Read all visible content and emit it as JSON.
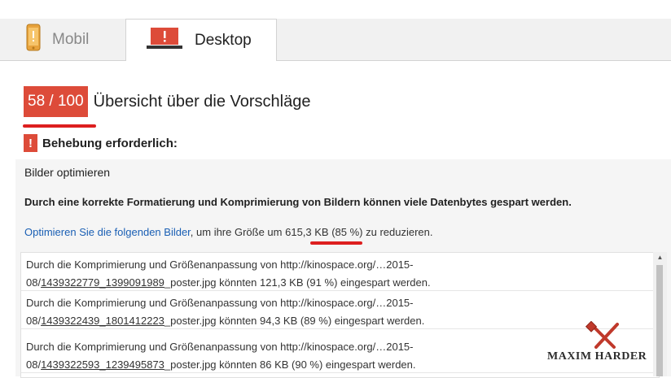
{
  "tabs": {
    "mobile": {
      "label": "Mobil",
      "icon": "phone-icon"
    },
    "desktop": {
      "label": "Desktop",
      "icon": "laptop-icon"
    }
  },
  "score": {
    "value": "58 / 100",
    "title": "Übersicht über die Vorschläge"
  },
  "fix": {
    "label": "Behebung erforderlich:"
  },
  "rule": {
    "title": "Bilder optimieren",
    "description": "Durch eine korrekte Formatierung und Komprimierung von Bildern können viele Datenbytes gespart werden.",
    "optimize_link": "Optimieren Sie die folgenden Bilder",
    "optimize_mid": ", um ihre Größe um ",
    "optimize_size": "615,3 KB",
    "optimize_rest": " (85 %) zu reduzieren."
  },
  "items": [
    {
      "prefix": "Durch die Komprimierung und Größenanpassung von http://kinospace.org/…2015-",
      "path_start": "08/",
      "file": "1439322779_1399091989",
      "suffix": "_poster.jpg könnten 121,3 KB (91 %) eingespart werden."
    },
    {
      "prefix": "Durch die Komprimierung und Größenanpassung von http://kinospace.org/…2015-",
      "path_start": "08/",
      "file": "1439322439_1801412223",
      "suffix": "_poster.jpg könnten 94,3 KB (89 %) eingespart werden."
    },
    {
      "prefix": "Durch die Komprimierung und Größenanpassung von http://kinospace.org/…2015-",
      "path_start": "08/",
      "file": "1439322593_1239495873",
      "suffix": "_poster.jpg könnten 86 KB (90 %) eingespart werden."
    }
  ],
  "watermark": {
    "text": "MAXIM HARDER"
  },
  "colors": {
    "accent_red": "#dd4b39",
    "link_blue": "#1a5fb4",
    "annotation_red": "#dd1f1f"
  }
}
